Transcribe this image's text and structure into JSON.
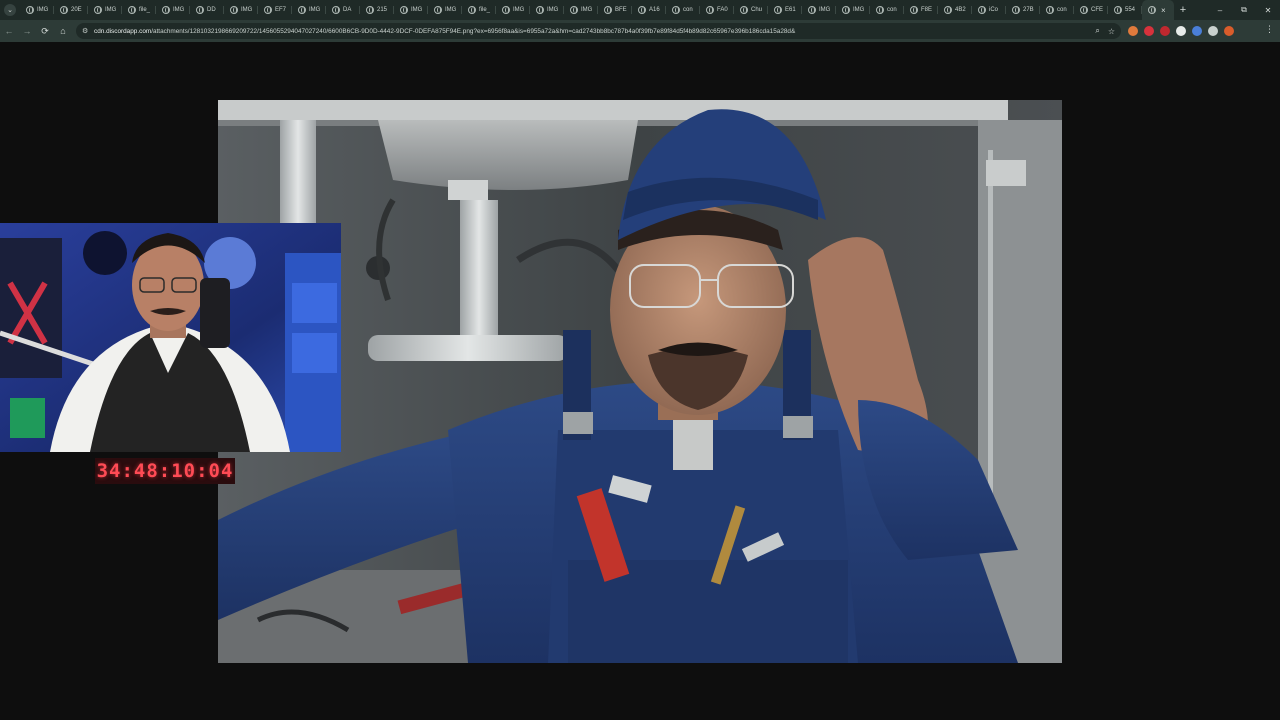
{
  "browser": {
    "tabs": [
      {
        "label": "IMG"
      },
      {
        "label": "20E"
      },
      {
        "label": "IMG"
      },
      {
        "label": "file_"
      },
      {
        "label": "IMG"
      },
      {
        "label": "DD"
      },
      {
        "label": "IMG"
      },
      {
        "label": "EF7"
      },
      {
        "label": "IMG"
      },
      {
        "label": "DA"
      },
      {
        "label": "215"
      },
      {
        "label": "IMG"
      },
      {
        "label": "IMG"
      },
      {
        "label": "file_"
      },
      {
        "label": "IMG"
      },
      {
        "label": "IMG"
      },
      {
        "label": "IMG"
      },
      {
        "label": "BFE"
      },
      {
        "label": "A16"
      },
      {
        "label": "con"
      },
      {
        "label": "FA0"
      },
      {
        "label": "Chu"
      },
      {
        "label": "E61"
      },
      {
        "label": "IMG"
      },
      {
        "label": "IMG"
      },
      {
        "label": "con"
      },
      {
        "label": "F8E"
      },
      {
        "label": "4B2"
      },
      {
        "label": "iCo"
      },
      {
        "label": "27B"
      },
      {
        "label": "con"
      },
      {
        "label": "CFE"
      },
      {
        "label": "554"
      }
    ],
    "active_tab_close": "×",
    "new_tab": "+",
    "window_controls": {
      "minimize": "–",
      "restore": "⧉",
      "close": "✕"
    },
    "nav": {
      "back": "←",
      "forward": "→",
      "reload": "⟳",
      "home": "⌂"
    },
    "url_host": "cdn.discordapp.com",
    "url_rest": "/attachments/1281032198669209722/1456055294047027240/6600B6CB-9D0D-4442-9DCF-0DEFA875F94E.png?ex=6956f8aa&is=6955a72a&hm=cad2743bb8bc787b4a0f39fb7e89f84d5f4b89d82c65967e396b186cda15a28d&",
    "omnibox_icons": {
      "zoom": "⌕",
      "bookmark": "☆"
    },
    "menu": "⋮",
    "extension_colors": [
      "#e07a3c",
      "#d8323c",
      "#c0282f",
      "#e8ecea",
      "#4a7fd8",
      "#c9d1ce",
      "#d95c2b"
    ]
  },
  "overlay": {
    "timer": "34:48:10:04",
    "timer_color": "#ff4b55"
  },
  "colors": {
    "page_bg": "#0e0e0e",
    "tabstrip_bg": "#1f2a27",
    "toolbar_bg": "#2d3b37"
  }
}
